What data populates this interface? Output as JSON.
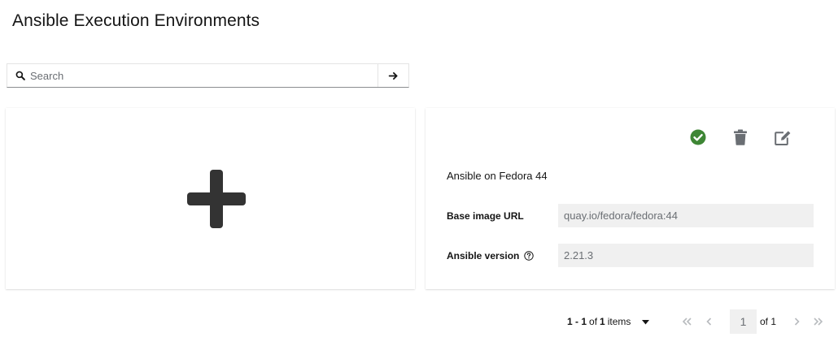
{
  "page": {
    "title": "Ansible Execution Environments"
  },
  "search": {
    "placeholder": "Search",
    "value": ""
  },
  "add_card": {
    "icon": "plus-icon"
  },
  "environment": {
    "name": "Ansible on Fedora 44",
    "actions": [
      {
        "icon": "check-circle-icon",
        "color": "#3e8635"
      },
      {
        "icon": "trash-icon",
        "color": "#6a6e73"
      },
      {
        "icon": "edit-icon",
        "color": "#6a6e73"
      }
    ],
    "fields": {
      "base_image_label": "Base image URL",
      "base_image_value": "quay.io/fedora/fedora:44",
      "ansible_version_label": "Ansible version",
      "ansible_version_value": "2.21.3"
    }
  },
  "pagination": {
    "range": "1 - 1",
    "of_word": "of",
    "total": "1",
    "items_word": "items",
    "current_page": "1",
    "of_pages": "of 1"
  },
  "colors": {
    "success": "#3e8635",
    "icon_gray": "#6a6e73",
    "field_bg": "#f0f0f0",
    "disabled": "#b8bbbe"
  }
}
